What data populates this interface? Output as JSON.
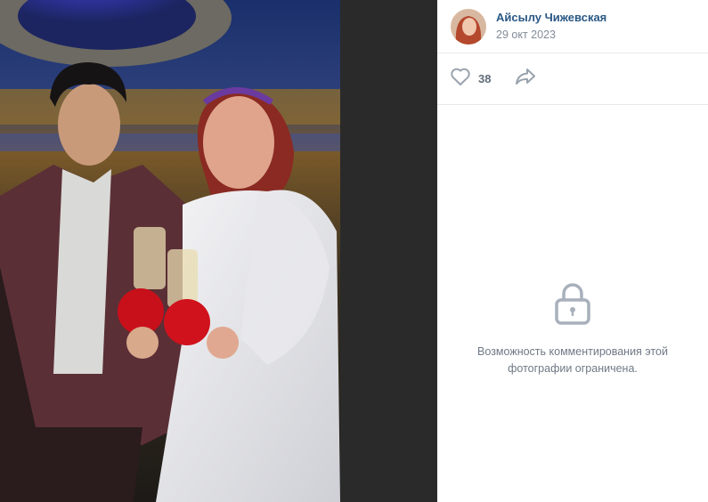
{
  "post": {
    "author_name": "Айсылу Чижевская",
    "date": "29 окт 2023",
    "likes": "38"
  },
  "icons": {
    "like": "heart-outline-icon",
    "share": "share-arrow-icon",
    "lock": "lock-icon"
  },
  "comments": {
    "restricted_message": "Возможность комментирования этой фотографии ограничена."
  },
  "colors": {
    "author_link": "#2a5885",
    "muted_text": "#818c99",
    "icon_gray": "#99a2ad",
    "viewer_background": "#2a2a2a"
  }
}
